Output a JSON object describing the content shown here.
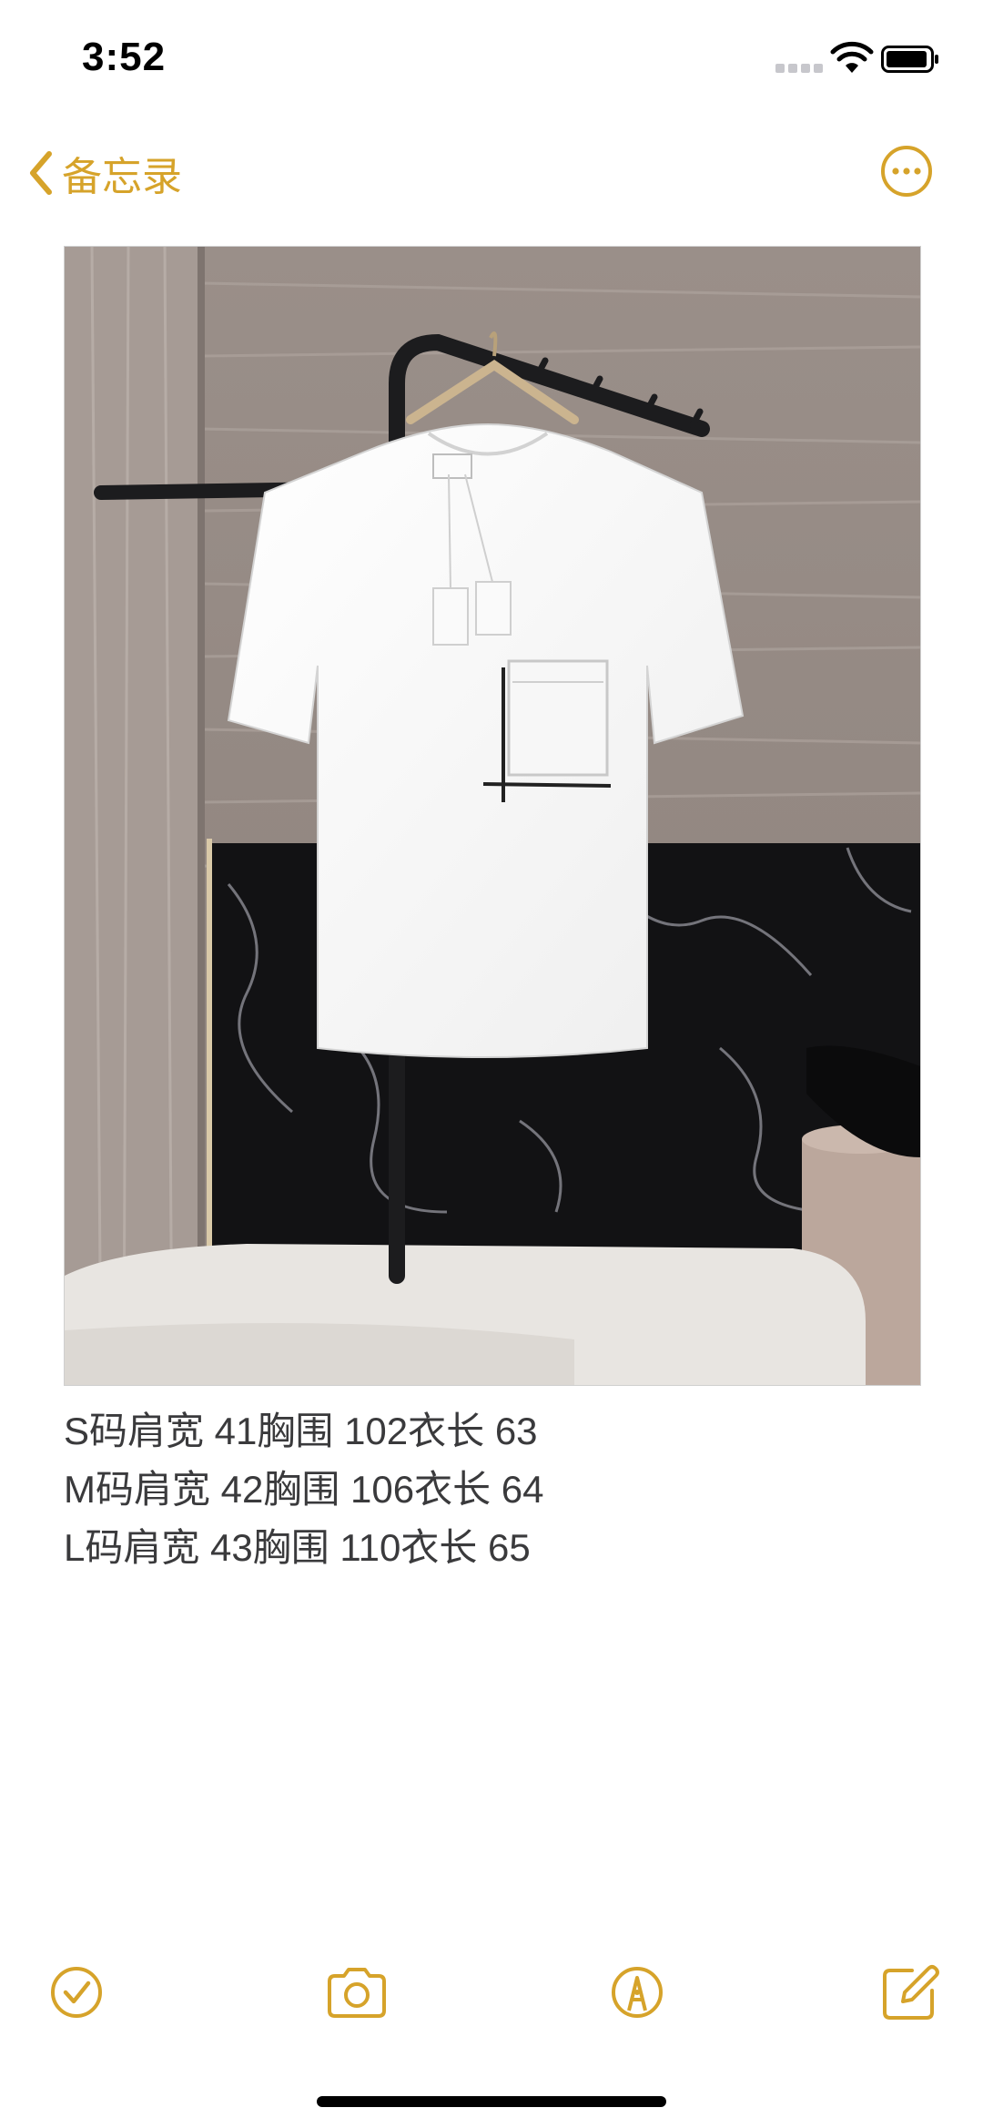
{
  "status_bar": {
    "time": "3:52"
  },
  "nav": {
    "back_label": "备忘录"
  },
  "note": {
    "lines": [
      "S码肩宽 41胸围 102衣长 63",
      "M码肩宽 42胸围 106衣长 64",
      "L码肩宽 43胸围 110衣长 65"
    ]
  },
  "icons": {
    "back": "chevron-left-icon",
    "more": "ellipsis-circle-icon",
    "checklist": "checkmark-circle-icon",
    "camera": "camera-icon",
    "markup": "pen-tip-circle-icon",
    "compose": "compose-icon"
  },
  "colors": {
    "accent": "#d6a32a",
    "text": "#3a3a3c"
  }
}
